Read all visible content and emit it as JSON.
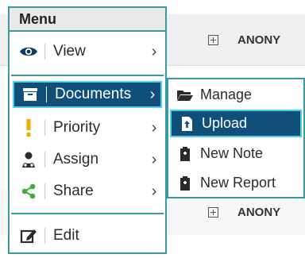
{
  "background": {
    "rows": [
      {
        "label": "ANONY"
      },
      {
        "label": "ANONY"
      }
    ]
  },
  "menu": {
    "title": "Menu",
    "items": [
      {
        "label": "View",
        "icon": "eye-icon"
      },
      {
        "label": "Documents",
        "icon": "archive-box-icon",
        "active": true
      },
      {
        "label": "Priority",
        "icon": "exclamation-icon"
      },
      {
        "label": "Assign",
        "icon": "user-assign-icon"
      },
      {
        "label": "Share",
        "icon": "share-icon"
      },
      {
        "label": "Edit",
        "icon": "edit-icon"
      }
    ]
  },
  "submenu": {
    "items": [
      {
        "label": "Manage",
        "icon": "folder-open-icon"
      },
      {
        "label": "Upload",
        "icon": "upload-file-icon",
        "active": true
      },
      {
        "label": "New Note",
        "icon": "clipboard-icon"
      },
      {
        "label": "New Report",
        "icon": "clipboard-icon"
      }
    ]
  },
  "colors": {
    "accent_border": "#3a9aa4",
    "active_bg": "#0f4f7a",
    "active_outline": "#4dd0e1",
    "icon_view": "#0b3b61",
    "icon_priority": "#f2a900",
    "icon_share": "#3fae3f"
  }
}
